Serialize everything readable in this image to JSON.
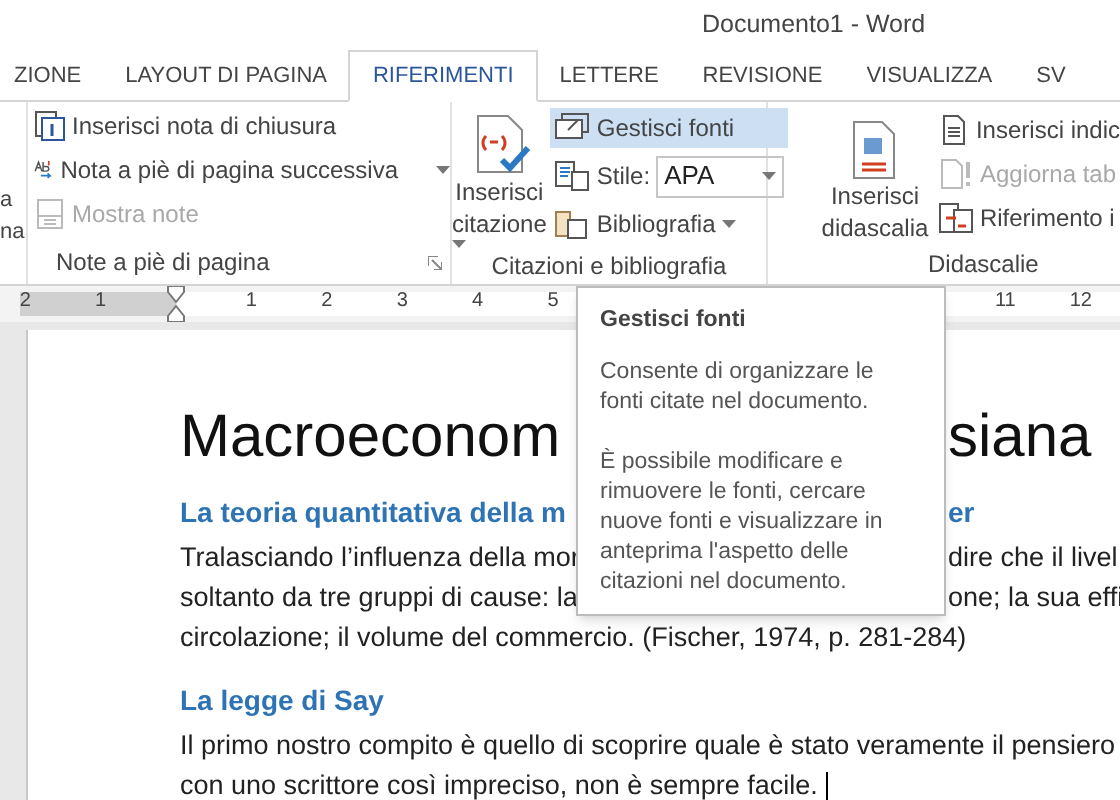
{
  "window": {
    "title": "Documento1 - Word"
  },
  "tabs": [
    {
      "label": "ZIONE",
      "selected": false
    },
    {
      "label": "LAYOUT DI PAGINA",
      "selected": false
    },
    {
      "label": "RIFERIMENTI",
      "selected": true
    },
    {
      "label": "LETTERE",
      "selected": false
    },
    {
      "label": "REVISIONE",
      "selected": false
    },
    {
      "label": "VISUALIZZA",
      "selected": false
    },
    {
      "label": "SV",
      "selected": false
    }
  ],
  "cut_group": {
    "lines": [
      "a",
      "na"
    ]
  },
  "footnotes_group": {
    "label": "Note a piè di pagina",
    "items": [
      {
        "label": "Inserisci nota di chiusura",
        "disabled": false,
        "dropdown": false,
        "kind": "endnote"
      },
      {
        "label": "Nota a piè di pagina successiva",
        "disabled": false,
        "dropdown": true,
        "kind": "next"
      },
      {
        "label": "Mostra note",
        "disabled": true,
        "dropdown": false,
        "kind": "show"
      }
    ]
  },
  "citations_group": {
    "label": "Citazioni e bibliografia",
    "insert": {
      "lines": [
        "Inserisci",
        "citazione"
      ]
    },
    "manage": {
      "label": "Gestisci fonti",
      "selected": true
    },
    "style": {
      "label": "Stile:",
      "value": "APA"
    },
    "bibliography": {
      "label": "Bibliografia"
    }
  },
  "captions_group": {
    "label": "Didascalie",
    "insert": {
      "lines": [
        "Inserisci",
        "didascalia"
      ]
    },
    "items": [
      {
        "label": "Inserisci indic",
        "disabled": false,
        "kind": "index"
      },
      {
        "label": "Aggiorna tab",
        "disabled": true,
        "kind": "update"
      },
      {
        "label": "Riferimento i",
        "disabled": false,
        "kind": "crossref"
      }
    ]
  },
  "ruler": {
    "numbers": [
      "2",
      "1",
      "1",
      "2",
      "3",
      "4",
      "5",
      "11",
      "12"
    ]
  },
  "document": {
    "blocks": [
      {
        "kind": "title",
        "lines": [
          {
            "left": "Macroeconom",
            "right": "siana"
          }
        ]
      },
      {
        "kind": "heading",
        "lines": [
          {
            "left": "La teoria quantitativa della m",
            "right": "er"
          }
        ]
      },
      {
        "kind": "body",
        "lines": [
          {
            "left": "Tralasciando l’influenza della mor",
            "right": "dire che il livel"
          },
          {
            "left": "soltanto da tre gruppi di cause: la",
            "right": "one; la sua effi"
          },
          {
            "left": "circolazione; il volume del commercio. (Fischer, 1974, p. 281-284)"
          }
        ]
      },
      {
        "kind": "heading",
        "lines": [
          {
            "left": "La legge di Say"
          }
        ]
      },
      {
        "kind": "body",
        "lines": [
          {
            "left": "Il primo nostro compito è quello di scoprire quale è stato veramente il pensiero"
          },
          {
            "left": "con uno scrittore così impreciso, non è sempre facile."
          }
        ]
      }
    ]
  },
  "tooltip": {
    "title": "Gestisci fonti",
    "paragraphs": [
      "Consente di organizzare le fonti citate nel documento.",
      "È possibile modificare e rimuovere le fonti, cercare nuove fonti e visualizzare in anteprima l'aspetto delle citazioni nel documento."
    ]
  }
}
